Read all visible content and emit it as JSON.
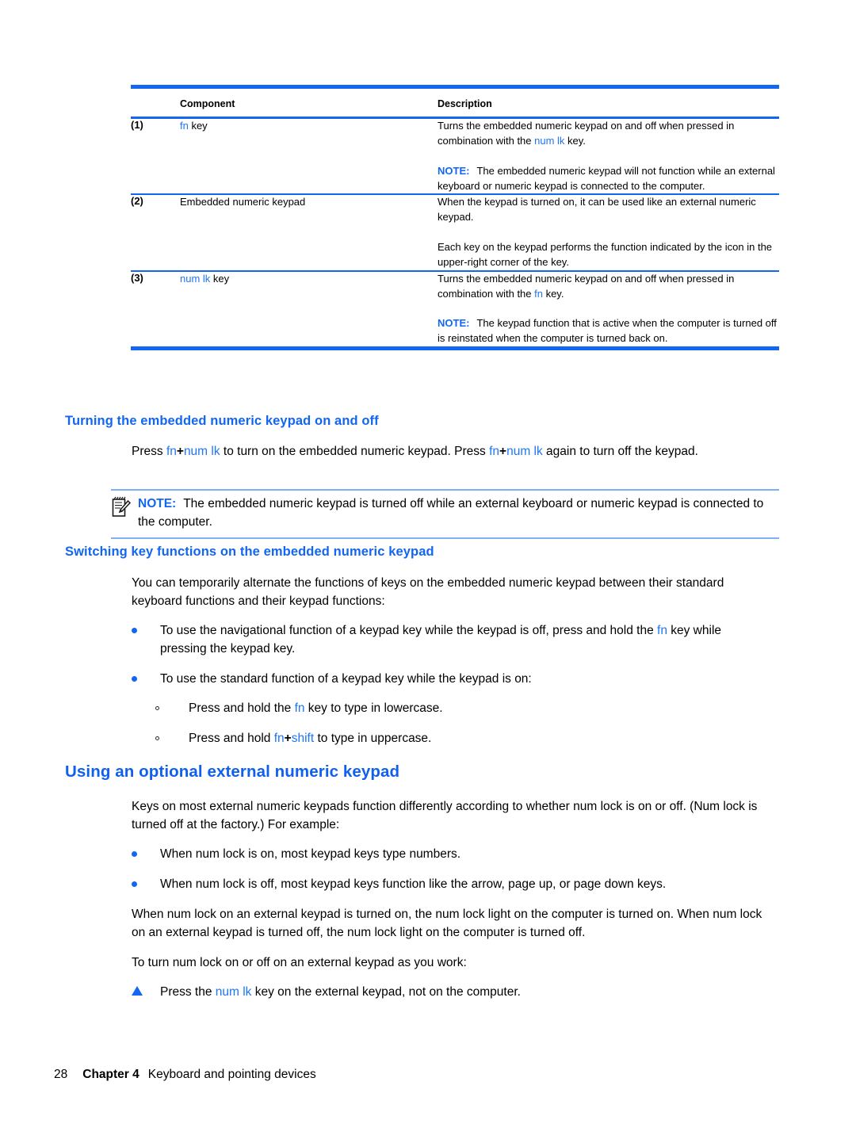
{
  "table": {
    "headers": [
      "Component",
      "Description"
    ],
    "rows": [
      {
        "num": "(1)",
        "component_pre": "",
        "component_kw": "fn",
        "component_post": " key",
        "desc_p1_a": "Turns the embedded numeric keypad on and off when pressed in combination with the ",
        "desc_p1_kw": "num lk",
        "desc_p1_b": " key.",
        "note_label": "NOTE:",
        "note_text": "The embedded numeric keypad will not function while an external keyboard or numeric keypad is connected to the computer."
      },
      {
        "num": "(2)",
        "component_plain": "Embedded numeric keypad",
        "desc_p1": "When the keypad is turned on, it can be used like an external numeric keypad.",
        "desc_p2": "Each key on the keypad performs the function indicated by the icon in the upper-right corner of the key."
      },
      {
        "num": "(3)",
        "component_kw": "num lk",
        "component_post": " key",
        "desc_p1_a": "Turns the embedded numeric keypad on and off when pressed in combination with the ",
        "desc_p1_kw": "fn",
        "desc_p1_b": " key.",
        "note_label": "NOTE:",
        "note_text": "The keypad function that is active when the computer is turned off is reinstated when the computer is turned back on."
      }
    ]
  },
  "section1": {
    "heading": "Turning the embedded numeric keypad on and off",
    "para_a": "Press ",
    "para_kw1": "fn",
    "para_plus1": "+",
    "para_kw2": "num lk",
    "para_b": " to turn on the embedded numeric keypad. Press ",
    "para_kw3": "fn",
    "para_plus2": "+",
    "para_kw4": "num lk",
    "para_c": " again to turn off the keypad.",
    "note_label": "NOTE:",
    "note_text": "The embedded numeric keypad is turned off while an external keyboard or numeric keypad is connected to the computer."
  },
  "section2": {
    "heading": "Switching key functions on the embedded numeric keypad",
    "intro": "You can temporarily alternate the functions of keys on the embedded numeric keypad between their standard keyboard functions and their keypad functions:",
    "bullet1_a": "To use the navigational function of a keypad key while the keypad is off, press and hold the ",
    "bullet1_kw": "fn",
    "bullet1_b": " key while pressing the keypad key.",
    "bullet2": "To use the standard function of a keypad key while the keypad is on:",
    "sub1_a": "Press and hold the ",
    "sub1_kw": "fn",
    "sub1_b": " key to type in lowercase.",
    "sub2_a": "Press and hold ",
    "sub2_kw1": "fn",
    "sub2_plus": "+",
    "sub2_kw2": "shift",
    "sub2_b": " to type in uppercase."
  },
  "section3": {
    "heading": "Using an optional external numeric keypad",
    "intro": "Keys on most external numeric keypads function differently according to whether num lock is on or off. (Num lock is turned off at the factory.) For example:",
    "bullet1": "When num lock is on, most keypad keys type numbers.",
    "bullet2": "When num lock is off, most keypad keys function like the arrow, page up, or page down keys.",
    "para1": "When num lock on an external keypad is turned on, the num lock light on the computer is turned on. When num lock on an external keypad is turned off, the num lock light on the computer is turned off.",
    "para2": "To turn num lock on or off on an external keypad as you work:",
    "step_a": "Press the ",
    "step_kw": "num lk",
    "step_b": " key on the external keypad, not on the computer."
  },
  "footer": {
    "page_number": "28",
    "chapter": "Chapter 4",
    "chapter_title": "Keyboard and pointing devices"
  },
  "colors": {
    "rule_blue": "#1266f1",
    "keyword_blue": "#1e75f5",
    "heading_blue": "#1060f0",
    "callout_rule": "#7fb0f7"
  }
}
